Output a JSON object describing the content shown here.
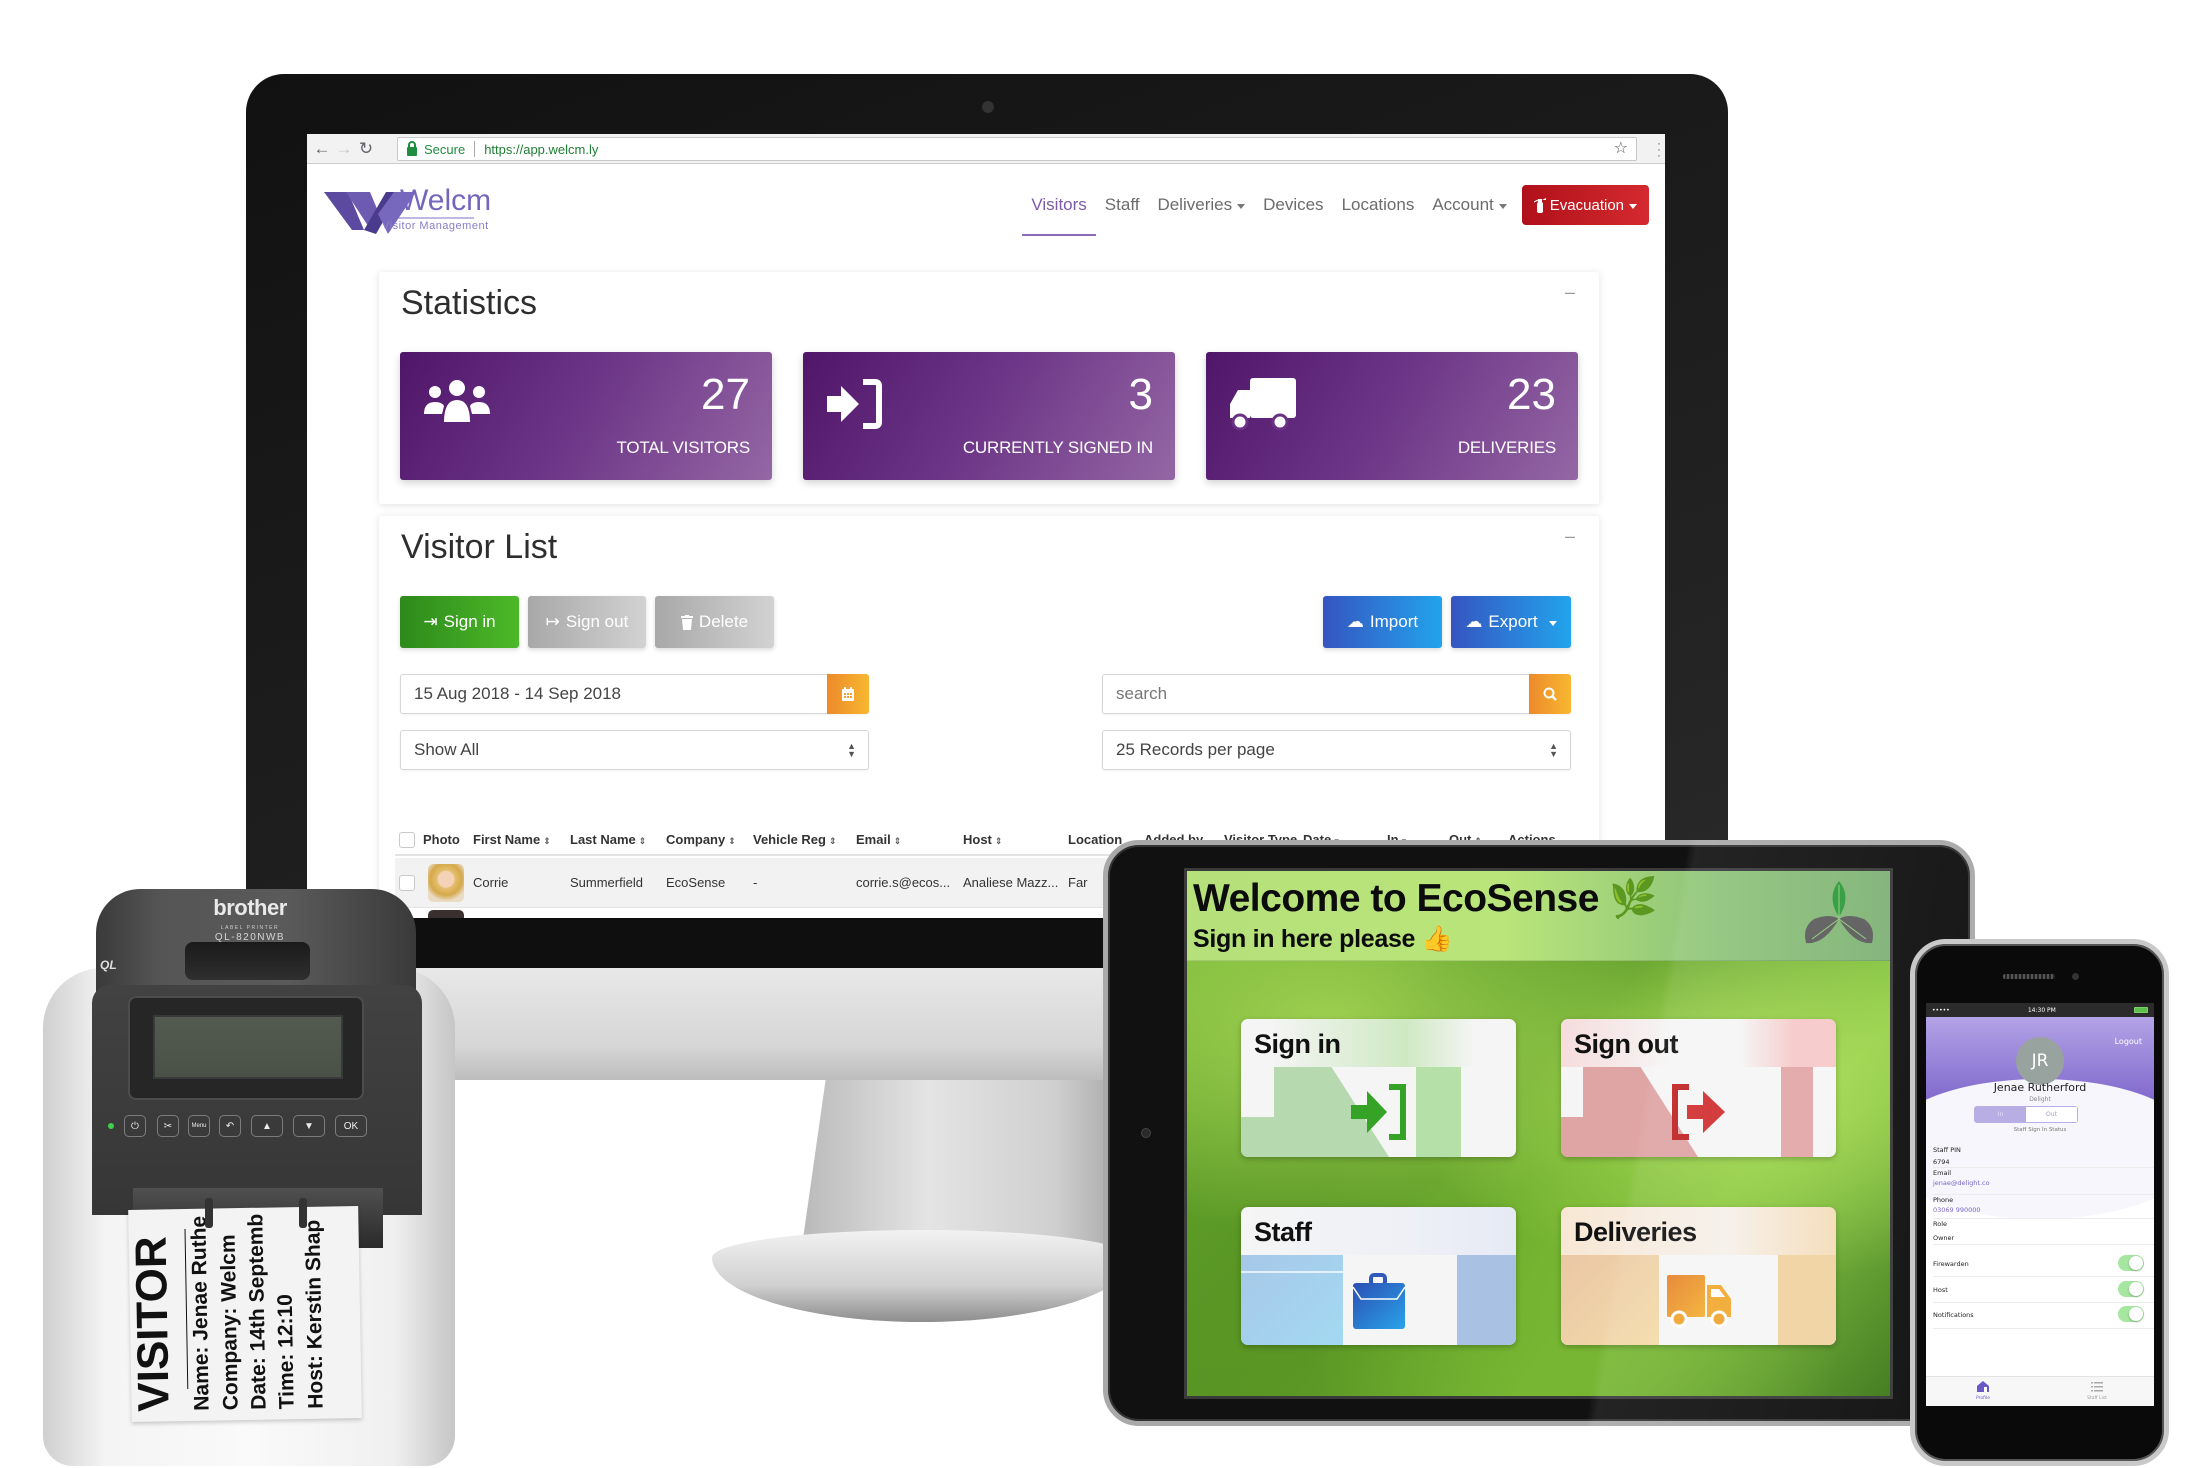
{
  "browser": {
    "secure_label": "Secure",
    "url": "https://app.welcm.ly"
  },
  "app": {
    "logo_name": "Welcm",
    "logo_tagline": "Visitor Management",
    "nav": [
      {
        "label": "Visitors",
        "active": true
      },
      {
        "label": "Staff"
      },
      {
        "label": "Deliveries",
        "dropdown": true
      },
      {
        "label": "Devices"
      },
      {
        "label": "Locations"
      },
      {
        "label": "Account",
        "dropdown": true
      }
    ],
    "evacuation_label": "Evacuation",
    "accent_color": "#7c5aa6",
    "evacuation_color": "#c21c24"
  },
  "statistics": {
    "title": "Statistics",
    "collapse": "–",
    "cards": [
      {
        "icon": "users-icon",
        "value": "27",
        "label": "TOTAL VISITORS"
      },
      {
        "icon": "sign-in-icon",
        "value": "3",
        "label": "CURRENTLY SIGNED IN"
      },
      {
        "icon": "truck-icon",
        "value": "23",
        "label": "DELIVERIES"
      }
    ]
  },
  "visitor_list": {
    "title": "Visitor List",
    "collapse": "–",
    "buttons": {
      "sign_in": "Sign in",
      "sign_out": "Sign out",
      "delete": "Delete",
      "import": "Import",
      "export": "Export"
    },
    "date_range": "15 Aug 2018 - 14 Sep 2018",
    "search_placeholder": "search",
    "filter_value": "Show All",
    "per_page_value": "25 Records per page",
    "columns": [
      "Photo",
      "First Name",
      "Last Name",
      "Company",
      "Vehicle Reg",
      "Email",
      "Host",
      "Location",
      "Added by",
      "Visitor Type",
      "Date",
      "In",
      "Out",
      "Actions"
    ],
    "rows": [
      {
        "first_name": "Corrie",
        "last_name": "Summerfield",
        "company": "EcoSense",
        "vehicle_reg": "-",
        "email": "corrie.s@ecos...",
        "host": "Analiese Mazz...",
        "location": "Far"
      }
    ]
  },
  "kiosk": {
    "title": "Welcome to EcoSense 🌿",
    "subtitle": "Sign in here please 👍",
    "tiles": [
      {
        "label": "Sign in",
        "icon": "sign-in-icon",
        "color": "#3aa52a"
      },
      {
        "label": "Sign out",
        "icon": "sign-out-icon",
        "color": "#c42a2a"
      },
      {
        "label": "Staff",
        "icon": "briefcase-icon",
        "color": "#2f6fd0"
      },
      {
        "label": "Deliveries",
        "icon": "truck-icon",
        "color": "#ef9a2a"
      }
    ]
  },
  "phone": {
    "time": "14:30 PM",
    "logout": "Logout",
    "initials": "JR",
    "name": "Jenae Rutherford",
    "company": "Delight",
    "status_in": "In",
    "status_out": "Out",
    "status_label": "Staff Sign In Status",
    "fields": [
      {
        "label": "Staff PIN",
        "value": "6794"
      },
      {
        "label": "Email",
        "value": "jenae@delight.co"
      },
      {
        "label": "Phone",
        "value": "03069 990000"
      },
      {
        "label": "Role",
        "value": "Owner"
      }
    ],
    "toggles": [
      {
        "label": "Firewarden",
        "on": true
      },
      {
        "label": "Host",
        "on": true
      },
      {
        "label": "Notifications",
        "on": true
      }
    ],
    "tabs": [
      "Profile",
      "Staff List"
    ]
  },
  "printer": {
    "brand": "brother",
    "model_sub": "LABEL PRINTER",
    "model": "QL-820NWB",
    "series": "QL",
    "buttons": [
      "⏻",
      "✂",
      "Menu",
      "↶",
      "▲",
      "▼",
      "OK"
    ],
    "label": {
      "heading": "VISITOR",
      "lines": [
        "Name: Jenae Ruthe",
        "Company: Welcm",
        "Date: 14th Septemb",
        "Time: 12:10",
        "Host: Kerstin Shap"
      ]
    }
  }
}
